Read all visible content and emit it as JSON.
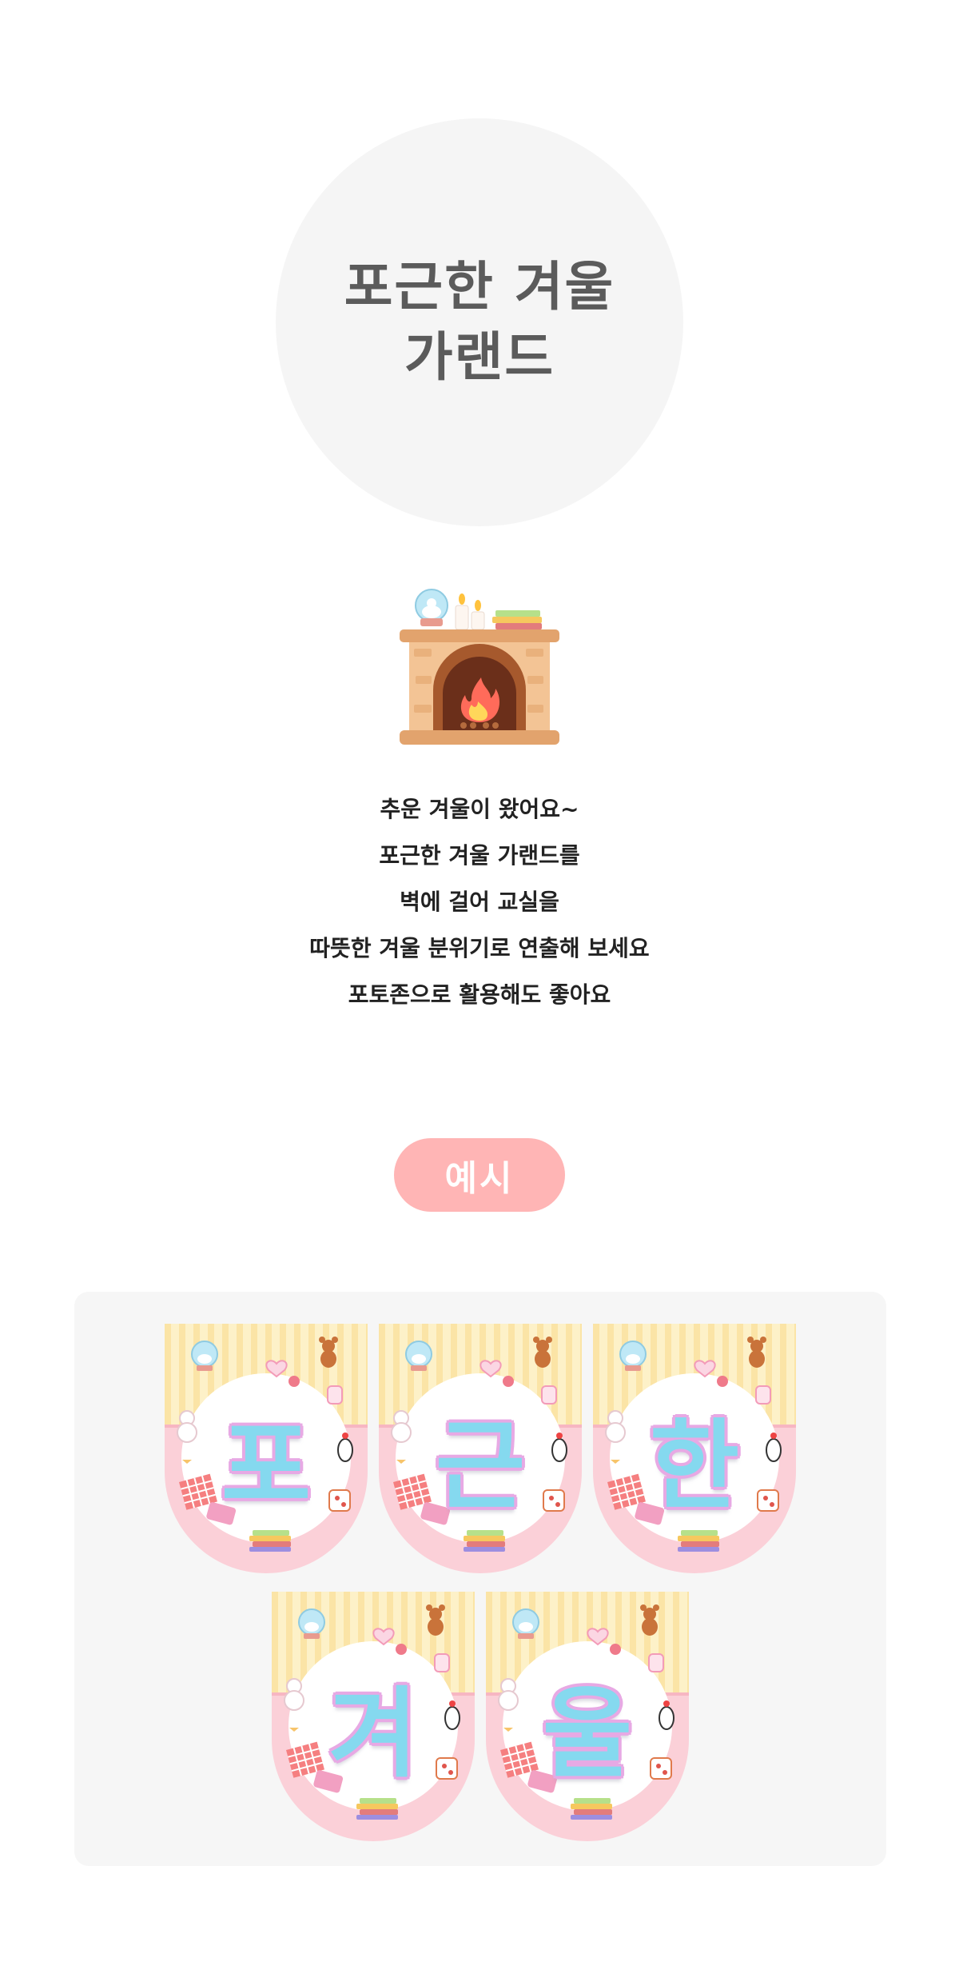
{
  "title": {
    "line1": "포근한 겨울",
    "line2": "가랜드"
  },
  "illustration": {
    "icon": "fireplace-icon"
  },
  "description": [
    "추운 겨울이 왔어요~",
    "포근한 겨울 가랜드를",
    "벽에 걸어 교실을",
    "따뜻한 겨울 분위기로 연출해 보세요",
    "포토존으로 활용해도 좋아요"
  ],
  "example_label": "예시",
  "garland": {
    "letters": [
      "포",
      "근",
      "한",
      "겨",
      "울"
    ],
    "colors": {
      "top_stripes": "#fdf1c8",
      "bottom": "#fbd0d8",
      "letter": "#85d9ef",
      "outline": "#e7a9e4"
    }
  },
  "colors": {
    "accent_pill": "#ffb5b5",
    "circle_bg": "#f5f5f5",
    "panel_bg": "#f6f6f6",
    "title_text": "#5b5b5b"
  }
}
